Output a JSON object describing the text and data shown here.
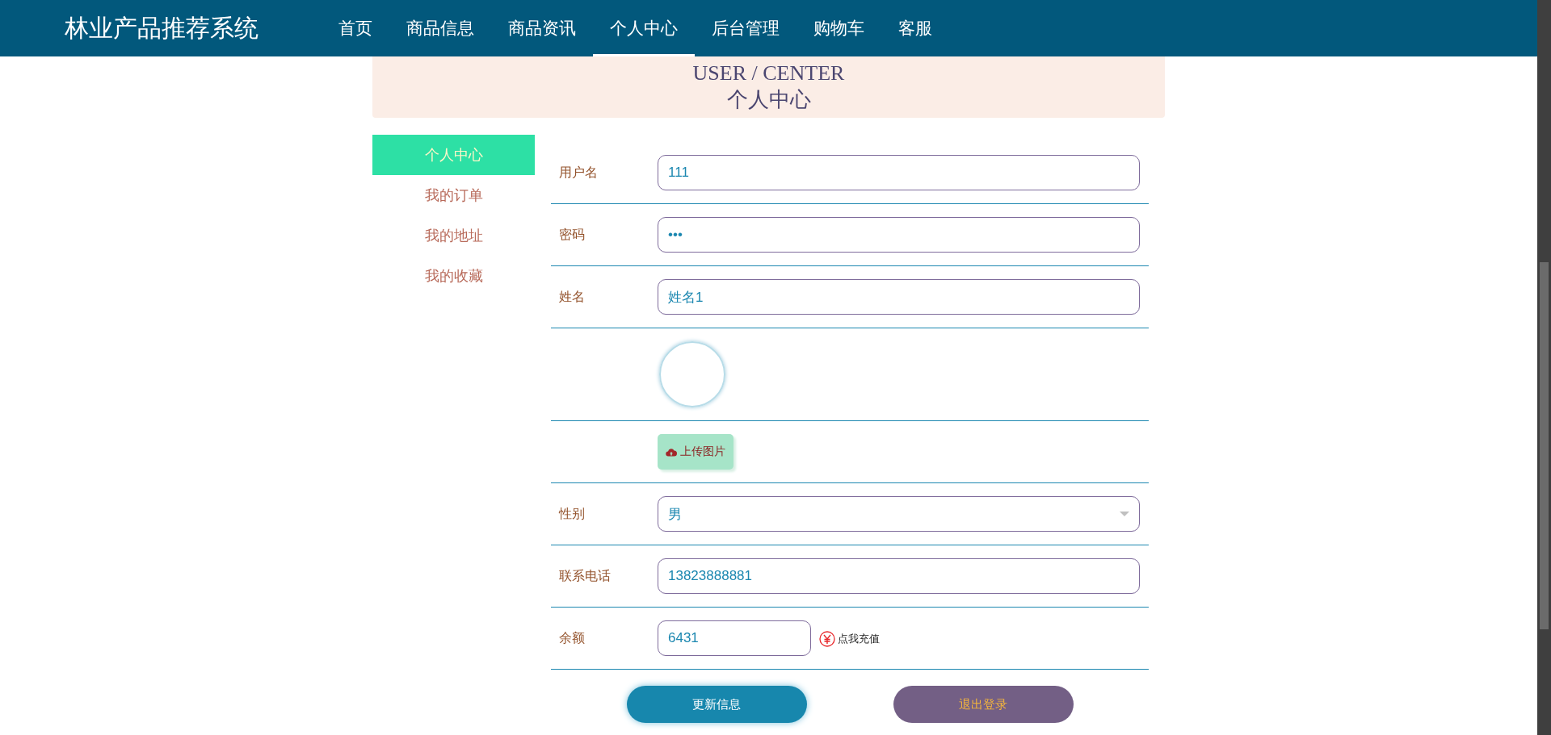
{
  "site_title": "林业产品推荐系统",
  "nav": [
    {
      "label": "首页",
      "selected": false
    },
    {
      "label": "商品信息",
      "selected": false
    },
    {
      "label": "商品资讯",
      "selected": false
    },
    {
      "label": "个人中心",
      "selected": true
    },
    {
      "label": "后台管理",
      "selected": false
    },
    {
      "label": "购物车",
      "selected": false
    },
    {
      "label": "客服",
      "selected": false
    }
  ],
  "banner": {
    "english": "USER / CENTER",
    "chinese": "个人中心"
  },
  "sidebar": {
    "items": [
      {
        "label": "个人中心",
        "selected": true
      },
      {
        "label": "我的订单",
        "selected": false
      },
      {
        "label": "我的地址",
        "selected": false
      },
      {
        "label": "我的收藏",
        "selected": false
      }
    ]
  },
  "form": {
    "rows": [
      {
        "kind": "input",
        "label": "用户名",
        "value": "111"
      },
      {
        "kind": "input",
        "label": "密码",
        "value": "•••"
      },
      {
        "kind": "input",
        "label": "姓名",
        "value": "姓名1"
      },
      {
        "kind": "avatar"
      },
      {
        "kind": "upload",
        "button": "上传图片"
      },
      {
        "kind": "select",
        "label": "性别",
        "value": "男"
      },
      {
        "kind": "input",
        "label": "联系电话",
        "value": "13823888881"
      },
      {
        "kind": "balance",
        "label": "余额",
        "value": "6431",
        "link": "点我充值"
      }
    ],
    "buttons": {
      "update": "更新信息",
      "logout": "退出登录"
    }
  }
}
